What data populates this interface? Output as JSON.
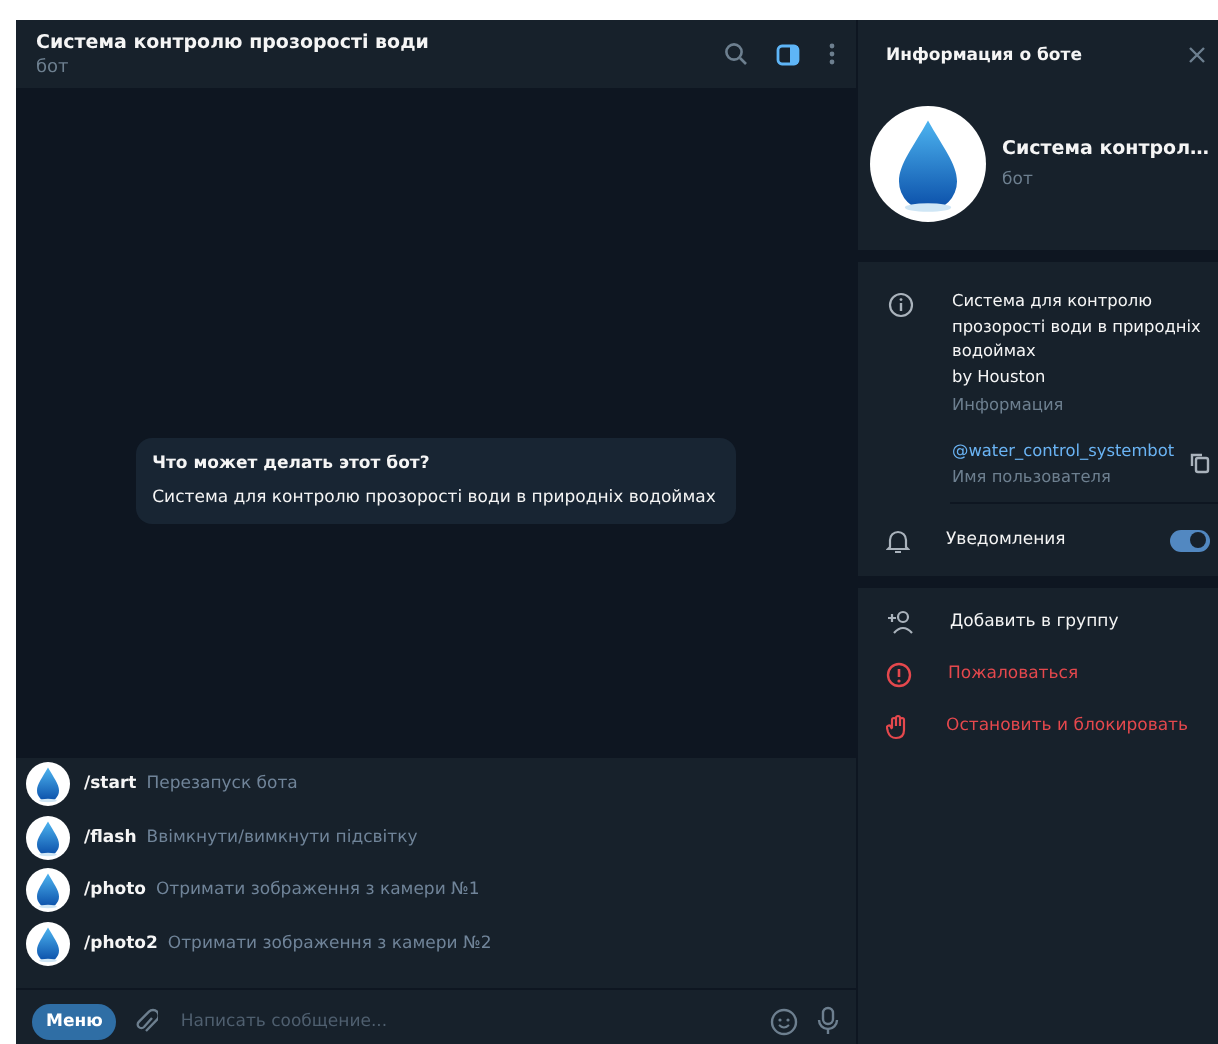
{
  "chat": {
    "title": "Система контролю прозорості води",
    "subtitle": "бот",
    "info_toggle": {
      "selected": true
    }
  },
  "bot_intro": {
    "heading": "Что может делать этот бот?",
    "text": "Система для контролю прозорості води в природніх водоймах"
  },
  "commands": [
    {
      "command": "/start",
      "description": "Перезапуск бота"
    },
    {
      "command": "/flash",
      "description": "Ввімкнути/вимкнути підсвітку"
    },
    {
      "command": "/photo",
      "description": "Отримати зображення з камери №1"
    },
    {
      "command": "/photo2",
      "description": "Отримати зображення з камери №2"
    }
  ],
  "composer": {
    "menu_button": "Меню",
    "placeholder": "Написать сообщение..."
  },
  "info_panel": {
    "title": "Информация о боте",
    "name": "Система контрол…",
    "subtitle": "бот",
    "about": "Система для контролю прозорості води в природніх водоймах\nby Houston",
    "about_label": "Информация",
    "username": "@water_control_systembot",
    "username_label": "Имя пользователя",
    "notifications": {
      "label": "Уведомления",
      "on": true
    },
    "actions": [
      {
        "label": "Добавить в группу",
        "kind": "add-member",
        "danger": false
      },
      {
        "label": "Пожаловаться",
        "kind": "report",
        "danger": true
      },
      {
        "label": "Остановить и блокировать",
        "kind": "block",
        "danger": true
      }
    ]
  }
}
